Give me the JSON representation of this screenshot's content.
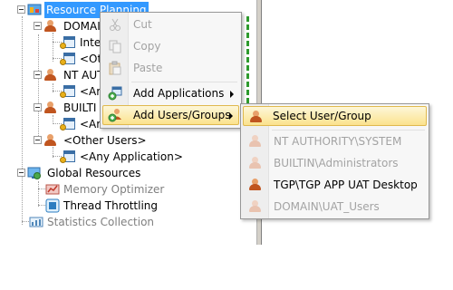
{
  "tree": {
    "root_label": "Resource Planning",
    "items": [
      {
        "label": "DOMAI"
      },
      {
        "label": "Inte"
      },
      {
        "label": "<Oth"
      },
      {
        "label": "NT AUT"
      },
      {
        "label": "<Ar"
      },
      {
        "label": "BUILTI"
      },
      {
        "label": "<Ar"
      },
      {
        "label": "<Other Users>"
      },
      {
        "label": "<Any Application>"
      },
      {
        "label": "Global Resources"
      },
      {
        "label": "Memory Optimizer"
      },
      {
        "label": "Thread Throttling"
      },
      {
        "label": "Statistics Collection"
      }
    ]
  },
  "context_menu": {
    "items": [
      {
        "label": "Cut",
        "enabled": false
      },
      {
        "label": "Copy",
        "enabled": false
      },
      {
        "label": "Paste",
        "enabled": false
      },
      {
        "label": "Add Applications",
        "enabled": true
      },
      {
        "label": "Add Users/Groups",
        "enabled": true
      }
    ]
  },
  "submenu": {
    "items": [
      {
        "label": "Select User/Group",
        "enabled": true
      },
      {
        "label": "NT AUTHORITY\\SYSTEM",
        "enabled": false
      },
      {
        "label": "BUILTIN\\Administrators",
        "enabled": false
      },
      {
        "label": "TGP\\TGP APP UAT Desktop",
        "enabled": true
      },
      {
        "label": "DOMAIN\\UAT_Users",
        "enabled": false
      }
    ]
  },
  "colors": {
    "selection": "#3399ff",
    "menu_highlight": "#fbe28d",
    "splitter_accent": "#2e9a2e"
  }
}
